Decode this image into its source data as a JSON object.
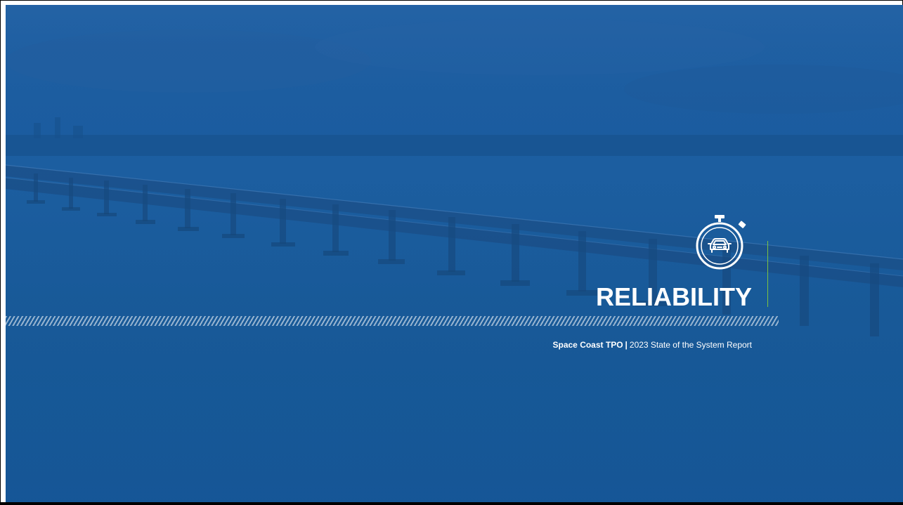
{
  "slide": {
    "title": "RELIABILITY",
    "organization": "Space Coast TPO",
    "separator": "|",
    "report_title": "2023 State of the System Report",
    "icon": "stopwatch-car-icon"
  },
  "colors": {
    "background_blue": "#1a5b9d",
    "accent_green": "#7cc242",
    "text_white": "#ffffff"
  }
}
